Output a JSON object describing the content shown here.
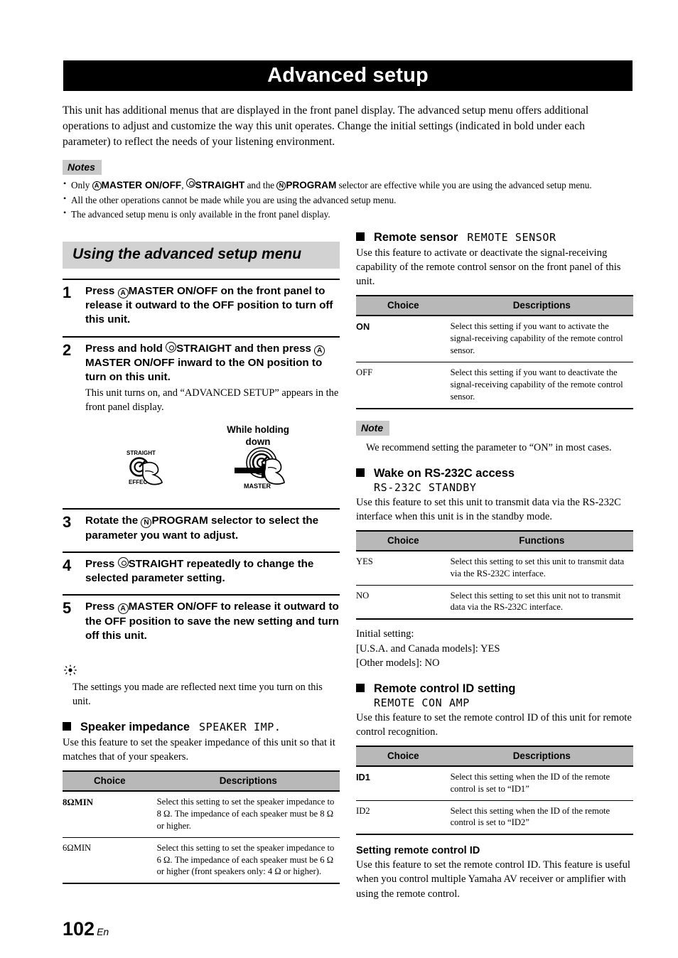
{
  "page": {
    "title": "Advanced setup",
    "footer_number": "102",
    "footer_lang": "En"
  },
  "intro": "This unit has additional menus that are displayed in the front panel display. The advanced setup menu offers additional operations to adjust and customize the way this unit operates. Change the initial settings (indicated in bold under each parameter) to reflect the needs of your listening environment.",
  "notes": {
    "label": "Notes",
    "items": [
      {
        "prefix": "Only ",
        "mark1": "A",
        "term1": "MASTER ON/OFF",
        "sep1": ", ",
        "mark2": "C",
        "term2": "STRAIGHT",
        "sep2": " and the ",
        "mark3": "N",
        "term3": "PROGRAM",
        "suffix": " selector are effective while you are using the advanced setup menu."
      },
      {
        "text": "All the other operations cannot be made while you are using the advanced setup menu."
      },
      {
        "text": "The advanced setup menu is only available in the front panel display."
      }
    ]
  },
  "section": {
    "heading": "Using the advanced setup menu",
    "steps": [
      {
        "num": "1",
        "head_pre": "Press ",
        "mark": "A",
        "head_term": "MASTER ON/OFF",
        "head_post": " on the front panel to release it outward to the OFF position to turn off this unit.",
        "sub": ""
      },
      {
        "num": "2",
        "head_pre": "Press and hold ",
        "mark": "C",
        "head_term": "STRAIGHT",
        "head_mid": " and then press ",
        "mark2": "A",
        "head_term2": "MASTER ON/OFF",
        "head_post": " inward to the ON position to turn on this unit.",
        "sub": "This unit turns on, and “ADVANCED SETUP” appears in the front panel display."
      },
      {
        "num": "3",
        "head_pre": "Rotate the ",
        "mark": "N",
        "head_term": "PROGRAM",
        "head_post": " selector to select the parameter you want to adjust.",
        "sub": ""
      },
      {
        "num": "4",
        "head_pre": "Press ",
        "mark": "C",
        "head_term": "STRAIGHT",
        "head_post": " repeatedly to change the selected parameter setting.",
        "sub": ""
      },
      {
        "num": "5",
        "head_pre": "Press ",
        "mark": "A",
        "head_term": "MASTER ON/OFF",
        "head_post": " to release it outward to the OFF position to save the new setting and turn off this unit.",
        "sub": ""
      }
    ],
    "diagram": {
      "label_line1": "While holding",
      "label_line2": "down",
      "knob_left_top": "STRAIGHT",
      "knob_left_bottom": "EFFECT",
      "knob_right_label": "MASTER"
    },
    "tip": "The settings you made are reflected next time you turn on this unit."
  },
  "speaker_impedance": {
    "title": "Speaker impedance",
    "display": "SPEAKER IMP.",
    "desc": "Use this feature to set the speaker impedance of this unit so that it matches that of your speakers.",
    "table": {
      "headers": [
        "Choice",
        "Descriptions"
      ],
      "rows": [
        {
          "choice": "8ΩMIN",
          "bold": true,
          "desc": "Select this setting to set the speaker impedance to 8 Ω. The impedance of each speaker must be 8 Ω or higher."
        },
        {
          "choice": "6ΩMIN",
          "bold": false,
          "desc": "Select this setting to set the speaker impedance to 6 Ω. The impedance of each speaker must be 6 Ω or higher (front speakers only: 4 Ω or higher)."
        }
      ]
    }
  },
  "remote_sensor": {
    "title": "Remote sensor",
    "display": "REMOTE SENSOR",
    "desc": "Use this feature to activate or deactivate the signal-receiving capability of the remote control sensor on the front panel of this unit.",
    "table": {
      "headers": [
        "Choice",
        "Descriptions"
      ],
      "rows": [
        {
          "choice": "ON",
          "bold": true,
          "desc": "Select this setting if you want to activate the signal-receiving capability of the remote control sensor."
        },
        {
          "choice": "OFF",
          "bold": false,
          "desc": "Select this setting if you want to deactivate the signal-receiving capability of the remote control sensor."
        }
      ]
    },
    "note_label": "Note",
    "note_text": "We recommend setting the parameter to “ON” in most cases."
  },
  "wake_rs232c": {
    "title": "Wake on RS-232C access",
    "display": "RS-232C STANDBY",
    "desc": "Use this feature to set this unit to transmit data via the RS-232C interface when this unit is in the standby mode.",
    "table": {
      "headers": [
        "Choice",
        "Functions"
      ],
      "rows": [
        {
          "choice": "YES",
          "bold": false,
          "desc": "Select this setting to set this unit to transmit data via the RS-232C interface."
        },
        {
          "choice": "NO",
          "bold": false,
          "desc": "Select this setting to set this unit not to transmit data via the RS-232C interface."
        }
      ]
    },
    "initial_lines": [
      "Initial setting:",
      "[U.S.A. and Canada models]: YES",
      "[Other models]: NO"
    ]
  },
  "remote_id": {
    "title": "Remote control ID setting",
    "display": "REMOTE CON AMP",
    "desc": "Use this feature to set the remote control ID of this unit for remote control recognition.",
    "table": {
      "headers": [
        "Choice",
        "Descriptions"
      ],
      "rows": [
        {
          "choice": "ID1",
          "bold": true,
          "desc": "Select this setting when the ID of the remote control is set to “ID1”"
        },
        {
          "choice": "ID2",
          "bold": false,
          "desc": "Select this setting when the ID of the remote control is set to “ID2”"
        }
      ]
    },
    "sub_heading": "Setting remote control ID",
    "sub_desc": "Use this feature to set the remote control ID. This feature is useful when you control multiple Yamaha AV receiver or amplifier with using the remote control."
  }
}
